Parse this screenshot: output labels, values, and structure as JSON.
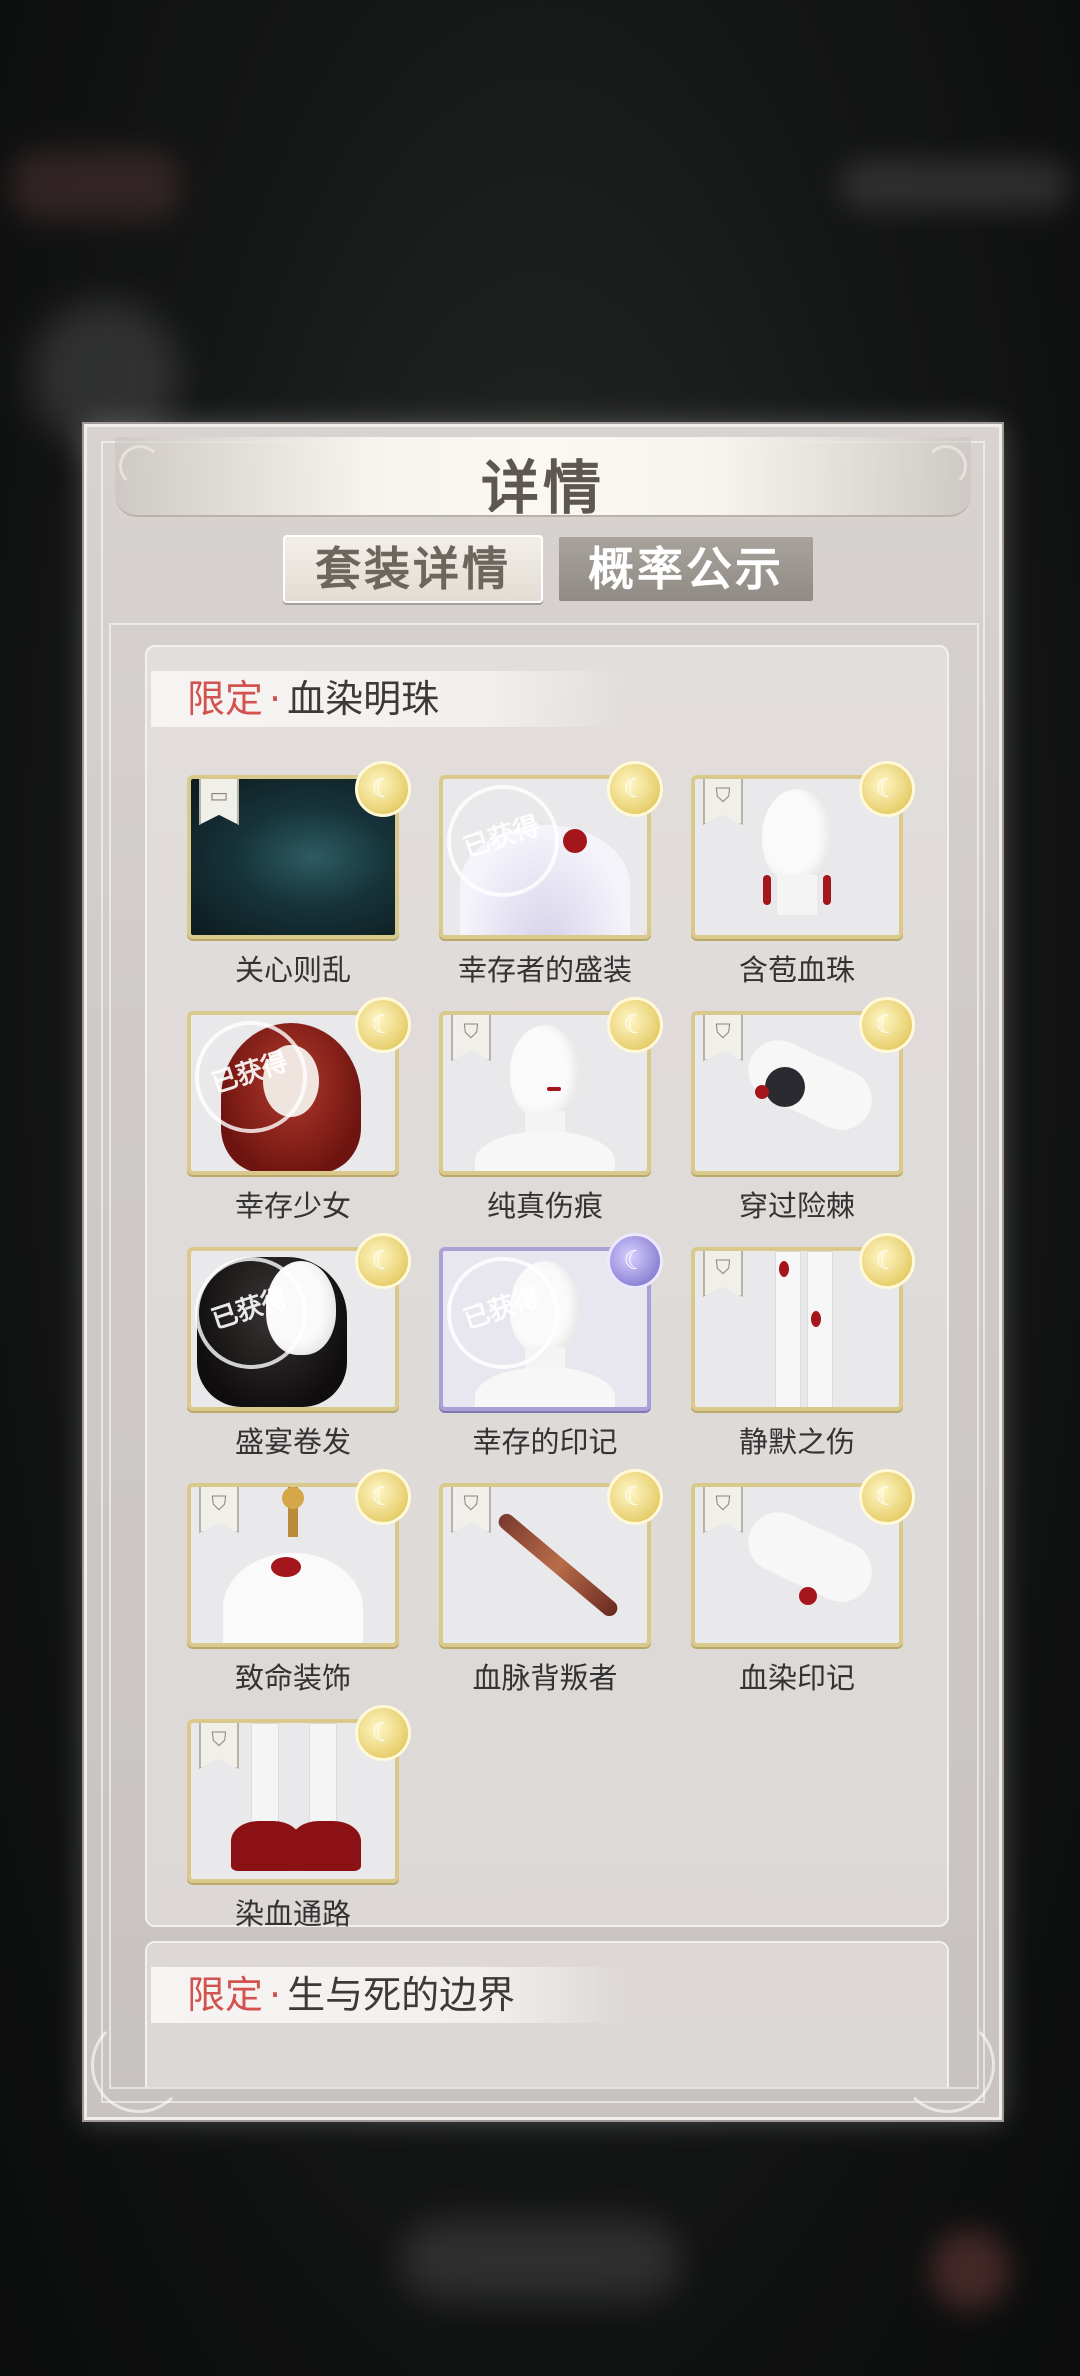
{
  "dialog": {
    "title": "详情",
    "tabs": [
      {
        "label": "套装详情",
        "active": true
      },
      {
        "label": "概率公示",
        "active": false
      }
    ]
  },
  "sets": [
    {
      "limited_label": "限定",
      "separator": "·",
      "name": "血染明珠",
      "items": [
        {
          "name": "关心则乱",
          "rarity": "gold",
          "tag": "card-icon",
          "owned": false
        },
        {
          "name": "幸存者的盛装",
          "rarity": "gold",
          "tag": "",
          "owned": true
        },
        {
          "name": "含苞血珠",
          "rarity": "gold",
          "tag": "accessory-icon",
          "owned": false
        },
        {
          "name": "幸存少女",
          "rarity": "gold",
          "tag": "",
          "owned": true
        },
        {
          "name": "纯真伤痕",
          "rarity": "gold",
          "tag": "accessory-icon",
          "owned": false
        },
        {
          "name": "穿过险棘",
          "rarity": "gold",
          "tag": "accessory-icon",
          "owned": false
        },
        {
          "name": "盛宴卷发",
          "rarity": "gold",
          "tag": "",
          "owned": true
        },
        {
          "name": "幸存的印记",
          "rarity": "purple",
          "tag": "",
          "owned": true
        },
        {
          "name": "静默之伤",
          "rarity": "gold",
          "tag": "accessory-icon",
          "owned": false
        },
        {
          "name": "致命装饰",
          "rarity": "gold",
          "tag": "accessory-icon",
          "owned": false
        },
        {
          "name": "血脉背叛者",
          "rarity": "gold",
          "tag": "accessory-icon",
          "owned": false
        },
        {
          "name": "血染印记",
          "rarity": "gold",
          "tag": "accessory-icon",
          "owned": false
        },
        {
          "name": "染血通路",
          "rarity": "gold",
          "tag": "accessory-icon",
          "owned": false
        }
      ]
    },
    {
      "limited_label": "限定",
      "separator": "·",
      "name": "生与死的边界",
      "items": []
    }
  ],
  "owned_stamp_text": "已获得",
  "colors": {
    "limited_red": "#d2524f",
    "gold_frame": "#d9c98a",
    "purple_frame": "#a9a0d6"
  }
}
